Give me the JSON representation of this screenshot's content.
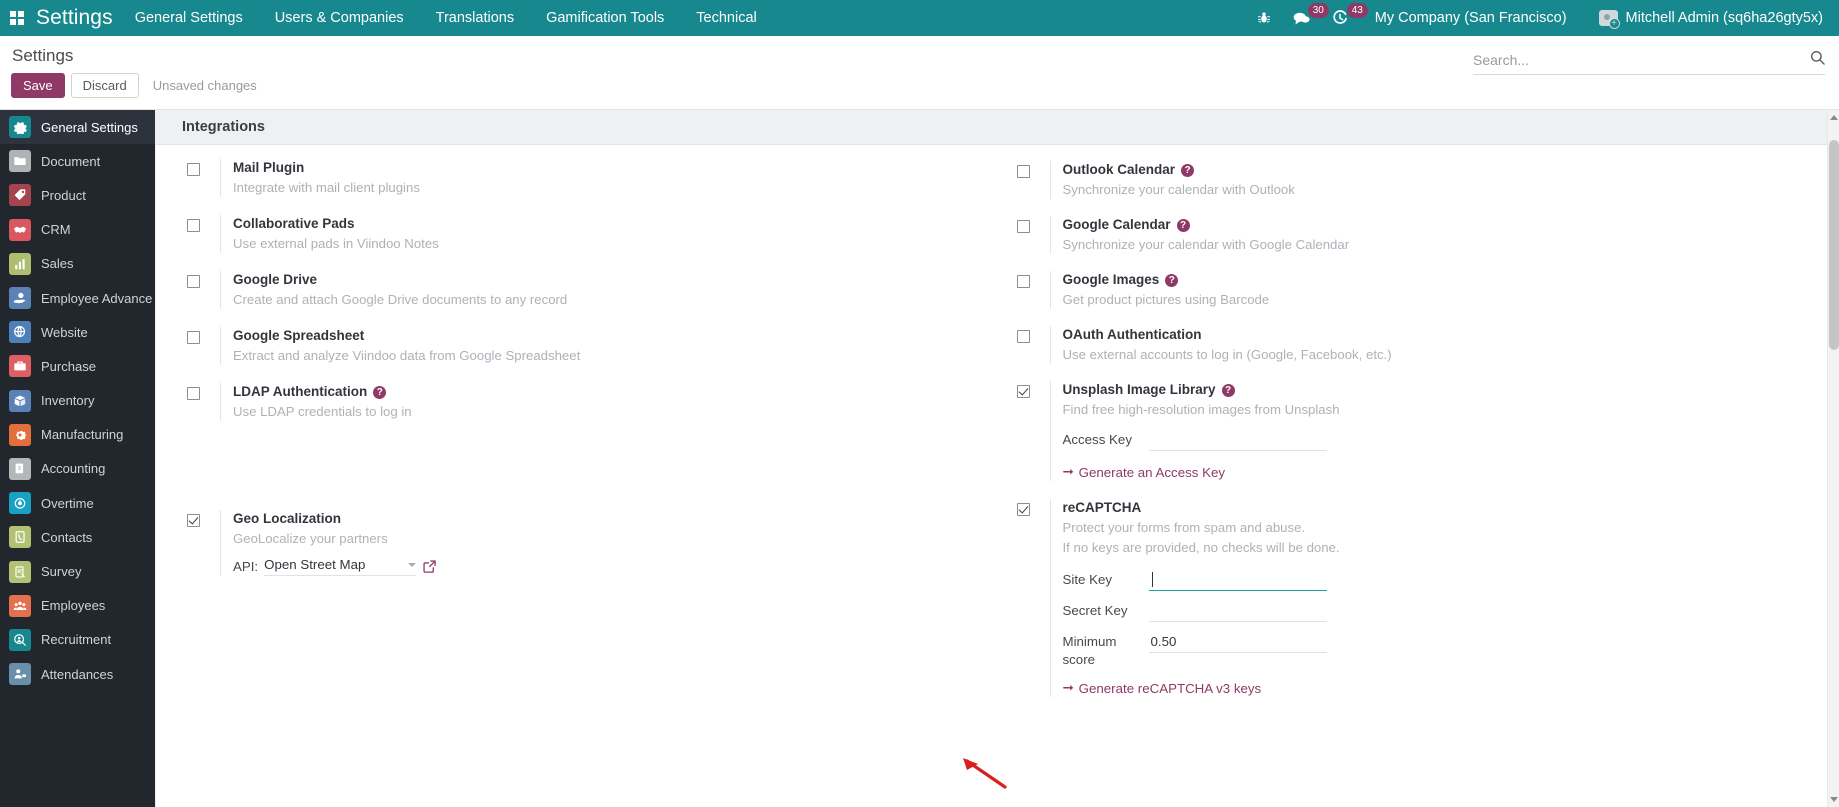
{
  "navbar": {
    "apps_icon": "apps-grid-icon",
    "brand": "Settings",
    "menus": [
      {
        "label": "General Settings",
        "name": "menu-general-settings"
      },
      {
        "label": "Users & Companies",
        "name": "menu-users-companies"
      },
      {
        "label": "Translations",
        "name": "menu-translations"
      },
      {
        "label": "Gamification Tools",
        "name": "menu-gamification-tools"
      },
      {
        "label": "Technical",
        "name": "menu-technical"
      }
    ],
    "debug_icon": "bug-icon",
    "messages_icon": "chat-bubble-icon",
    "messages_count": "30",
    "activities_icon": "clock-activity-icon",
    "activities_count": "43",
    "company": "My Company (San Francisco)",
    "user": "Mitchell Admin (sq6ha26gty5x)",
    "badge_color": "#8f3a66",
    "bg_color": "#17888e"
  },
  "control_panel": {
    "title": "Settings",
    "save_label": "Save",
    "discard_label": "Discard",
    "unsaved_label": "Unsaved changes",
    "search_placeholder": "Search...",
    "search_value": "",
    "search_icon": "search-icon"
  },
  "sidebar": {
    "items": [
      {
        "label": "General Settings",
        "icon": "gear-icon",
        "color": "#17888e",
        "active": true
      },
      {
        "label": "Document",
        "icon": "folder-icon",
        "color": "#b0b3b6",
        "active": false
      },
      {
        "label": "Product",
        "icon": "tag-icon",
        "color": "#a4444f",
        "active": false
      },
      {
        "label": "CRM",
        "icon": "handshake-icon",
        "color": "#d9575f",
        "active": false
      },
      {
        "label": "Sales",
        "icon": "bar-chart-icon",
        "color": "#aebe6e",
        "active": false
      },
      {
        "label": "Employee Advance",
        "icon": "hand-money-icon",
        "color": "#5b82b5",
        "active": false
      },
      {
        "label": "Website",
        "icon": "globe-cursor-icon",
        "color": "#4d7fb8",
        "active": false
      },
      {
        "label": "Purchase",
        "icon": "briefcase-icon",
        "color": "#dd5f63",
        "active": false
      },
      {
        "label": "Inventory",
        "icon": "box-icon",
        "color": "#5b82b5",
        "active": false
      },
      {
        "label": "Manufacturing",
        "icon": "cog-wrench-icon",
        "color": "#e3703c",
        "active": false
      },
      {
        "label": "Accounting",
        "icon": "invoice-icon",
        "color": "#b4b7ba",
        "active": false
      },
      {
        "label": "Overtime",
        "icon": "stopwatch-icon",
        "color": "#17a2c4",
        "active": false
      },
      {
        "label": "Contacts",
        "icon": "phone-book-icon",
        "color": "#b2c173",
        "active": false
      },
      {
        "label": "Survey",
        "icon": "clipboard-icon",
        "color": "#b2c173",
        "active": false
      },
      {
        "label": "Employees",
        "icon": "people-icon",
        "color": "#e3714f",
        "active": false
      },
      {
        "label": "Recruitment",
        "icon": "magnify-user-icon",
        "color": "#17888e",
        "active": false
      },
      {
        "label": "Attendances",
        "icon": "person-badge-icon",
        "color": "#6a8fa8",
        "active": false
      }
    ]
  },
  "main": {
    "section_title": "Integrations",
    "left_settings": [
      {
        "title": "Mail Plugin",
        "desc": "Integrate with mail client plugins",
        "checked": false,
        "help": false
      },
      {
        "title": "Collaborative Pads",
        "desc": "Use external pads in Viindoo Notes",
        "checked": false,
        "help": false
      },
      {
        "title": "Google Drive",
        "desc": "Create and attach Google Drive documents to any record",
        "checked": false,
        "help": false
      },
      {
        "title": "Google Spreadsheet",
        "desc": "Extract and analyze Viindoo data from Google Spreadsheet",
        "checked": false,
        "help": false
      },
      {
        "title": "LDAP Authentication",
        "desc": "Use LDAP credentials to log in",
        "checked": false,
        "help": true
      }
    ],
    "geo_localization": {
      "title": "Geo Localization",
      "desc": "GeoLocalize your partners",
      "checked": true,
      "api_label": "API:",
      "api_value": "Open Street Map",
      "external_link_icon": "external-link-icon",
      "dropdown_icon": "chevron-down-icon"
    },
    "right_settings": [
      {
        "title": "Outlook Calendar",
        "desc": "Synchronize your calendar with Outlook",
        "checked": false,
        "help": true
      },
      {
        "title": "Google Calendar",
        "desc": "Synchronize your calendar with Google Calendar",
        "checked": false,
        "help": true
      },
      {
        "title": "Google Images",
        "desc": "Get product pictures using Barcode",
        "checked": false,
        "help": true
      },
      {
        "title": "OAuth Authentication",
        "desc": "Use external accounts to log in (Google, Facebook, etc.)",
        "checked": false,
        "help": false
      }
    ],
    "unsplash": {
      "title": "Unsplash Image Library",
      "desc": "Find free high-resolution images from Unsplash",
      "checked": true,
      "help": true,
      "access_key_label": "Access Key",
      "access_key_value": "",
      "generate_link": "Generate an Access Key",
      "link_icon": "arrow-right-icon"
    },
    "recaptcha": {
      "title": "reCAPTCHA",
      "desc_line1": "Protect your forms from spam and abuse.",
      "desc_line2": "If no keys are provided, no checks will be done.",
      "checked": true,
      "help": false,
      "site_key_label": "Site Key",
      "site_key_value": "",
      "secret_key_label": "Secret Key",
      "secret_key_value": "",
      "min_score_label": "Minimum score",
      "min_score_value": "0.50",
      "generate_link": "Generate reCAPTCHA v3 keys",
      "link_icon": "arrow-right-icon",
      "focused_field": "site-key-input",
      "focus_color": "#17a2ae"
    },
    "annotation": {
      "arrow_icon": "red-pointer-arrow",
      "color": "#d92020"
    }
  }
}
